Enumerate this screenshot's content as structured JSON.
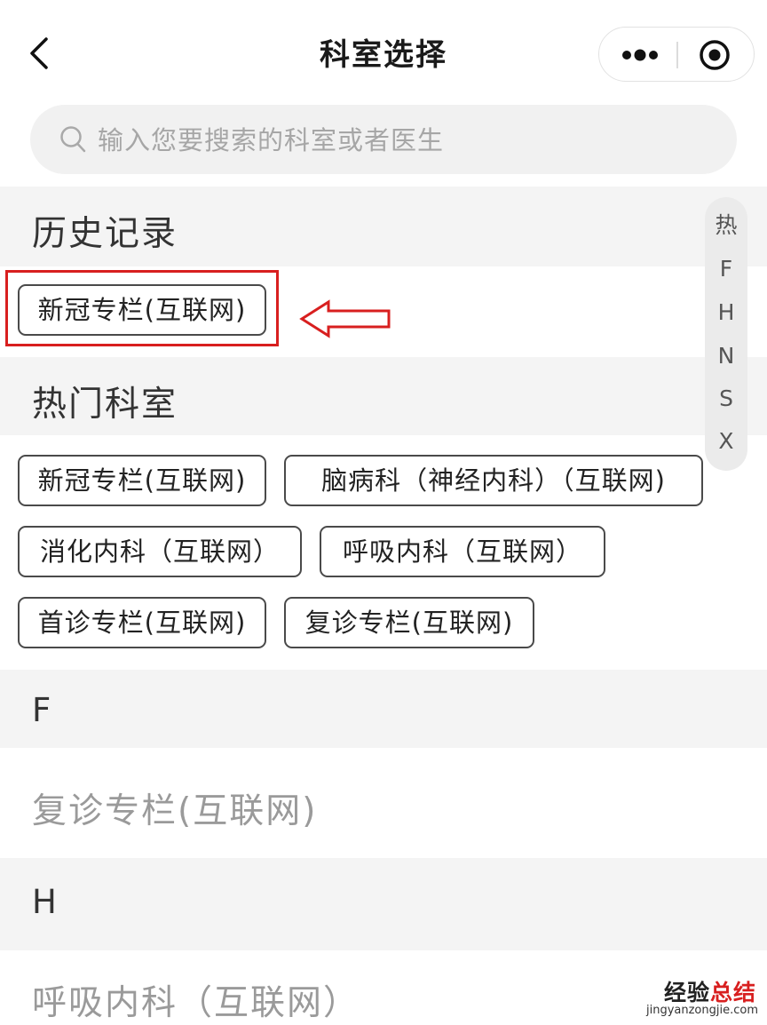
{
  "nav": {
    "title": "科室选择"
  },
  "search": {
    "placeholder": "输入您要搜索的科室或者医生",
    "value": ""
  },
  "sections": {
    "history": {
      "title": "历史记录",
      "tags": [
        "新冠专栏(互联网)"
      ]
    },
    "hot": {
      "title": "热门科室",
      "tags": [
        "新冠专栏(互联网)",
        "脑病科（神经内科）（互联网)",
        "消化内科（互联网）",
        "呼吸内科（互联网）",
        "首诊专栏(互联网)",
        "复诊专栏(互联网)"
      ]
    },
    "groups": [
      {
        "letter": "F",
        "items": [
          "复诊专栏(互联网)"
        ]
      },
      {
        "letter": "H",
        "items": [
          "呼吸内科（互联网）"
        ]
      }
    ]
  },
  "index_bar": [
    "热",
    "F",
    "H",
    "N",
    "S",
    "X"
  ],
  "annotation": {
    "highlight_color": "#d81f1f"
  },
  "watermark": {
    "brand_a": "经验",
    "brand_b": "总结",
    "url": "jingyanzongjie.com"
  }
}
